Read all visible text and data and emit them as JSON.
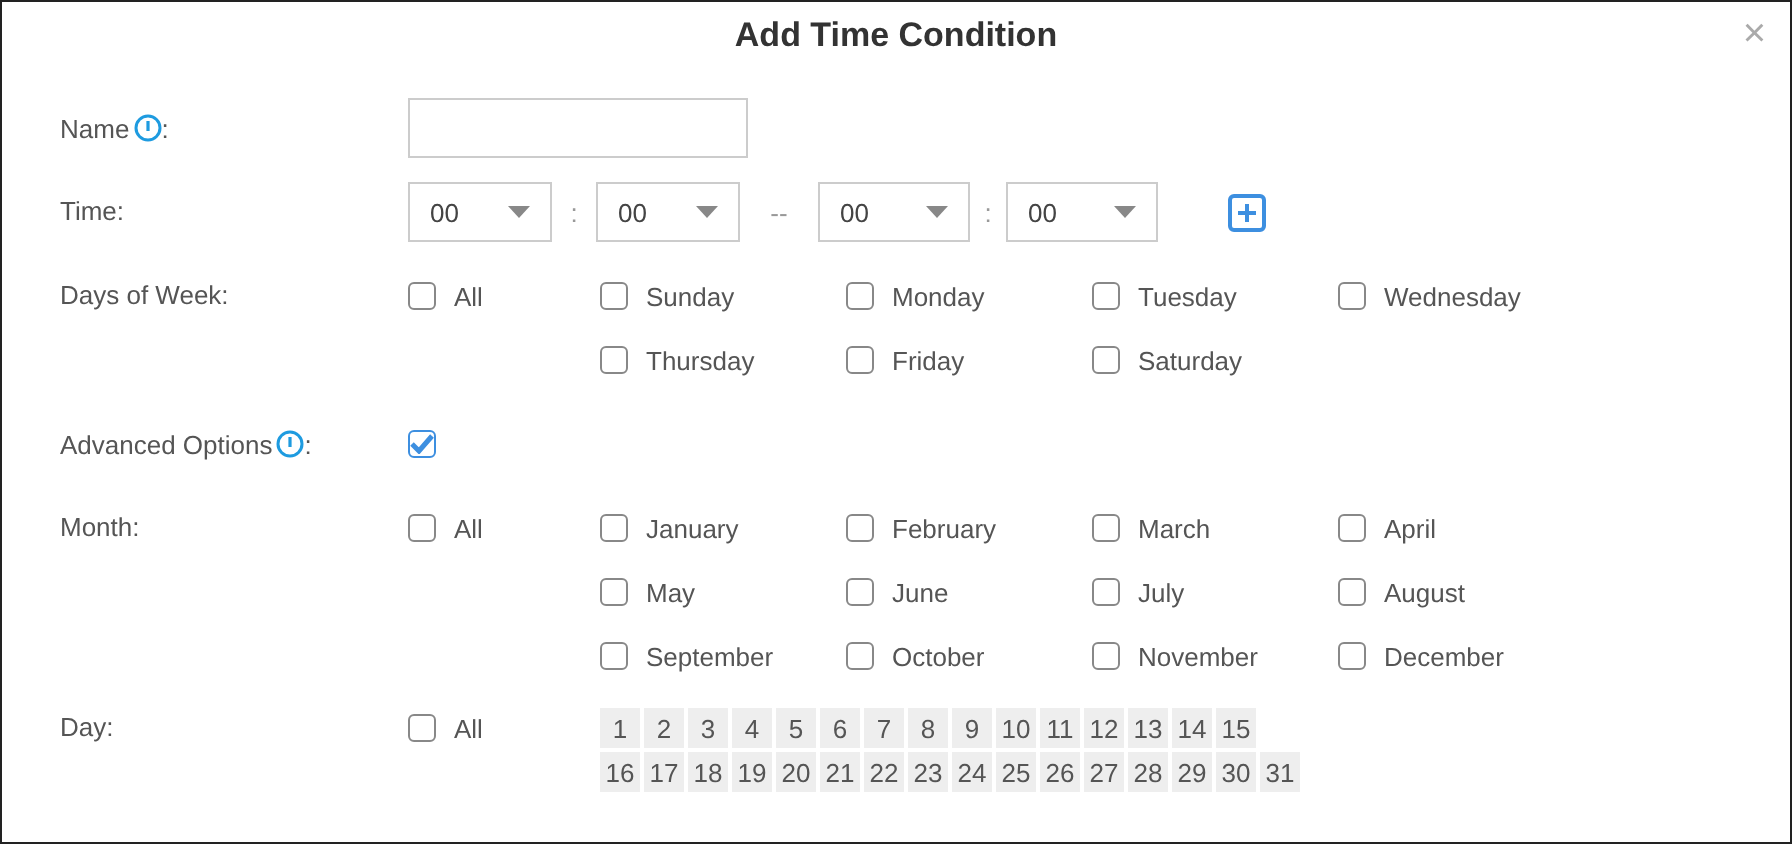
{
  "dialog": {
    "title": "Add Time Condition",
    "close": "×"
  },
  "name": {
    "label": "Name",
    "suffix": ":"
  },
  "time": {
    "label": "Time:",
    "selects": [
      "00",
      "00",
      "00",
      "00"
    ],
    "colon": ":",
    "dash": "--"
  },
  "days_of_week": {
    "label": "Days of Week:",
    "all": {
      "label": "All",
      "checked": false
    },
    "items": [
      {
        "label": "Sunday",
        "checked": false
      },
      {
        "label": "Monday",
        "checked": false
      },
      {
        "label": "Tuesday",
        "checked": false
      },
      {
        "label": "Wednesday",
        "checked": false
      },
      {
        "label": "Thursday",
        "checked": false
      },
      {
        "label": "Friday",
        "checked": false
      },
      {
        "label": "Saturday",
        "checked": false
      }
    ]
  },
  "advanced": {
    "label": "Advanced Options",
    "suffix": ":",
    "checked": true
  },
  "month": {
    "label": "Month:",
    "all": {
      "label": "All",
      "checked": false
    },
    "items": [
      {
        "label": "January",
        "checked": false
      },
      {
        "label": "February",
        "checked": false
      },
      {
        "label": "March",
        "checked": false
      },
      {
        "label": "April",
        "checked": false
      },
      {
        "label": "May",
        "checked": false
      },
      {
        "label": "June",
        "checked": false
      },
      {
        "label": "July",
        "checked": false
      },
      {
        "label": "August",
        "checked": false
      },
      {
        "label": "September",
        "checked": false
      },
      {
        "label": "October",
        "checked": false
      },
      {
        "label": "November",
        "checked": false
      },
      {
        "label": "December",
        "checked": false
      }
    ]
  },
  "day": {
    "label": "Day:",
    "all": {
      "label": "All",
      "checked": false
    },
    "lines": [
      {
        "days": [
          {
            "label": "1",
            "selected": false
          },
          {
            "label": "2",
            "selected": false
          },
          {
            "label": "3",
            "selected": false
          },
          {
            "label": "4",
            "selected": false
          },
          {
            "label": "5",
            "selected": false
          },
          {
            "label": "6",
            "selected": false
          },
          {
            "label": "7",
            "selected": false
          },
          {
            "label": "8",
            "selected": false
          },
          {
            "label": "9",
            "selected": false
          },
          {
            "label": "10",
            "selected": false
          },
          {
            "label": "11",
            "selected": false
          },
          {
            "label": "12",
            "selected": false
          },
          {
            "label": "13",
            "selected": false
          },
          {
            "label": "14",
            "selected": false
          },
          {
            "label": "15",
            "selected": false
          }
        ]
      },
      {
        "days": [
          {
            "label": "16",
            "selected": false
          },
          {
            "label": "17",
            "selected": false
          },
          {
            "label": "18",
            "selected": false
          },
          {
            "label": "19",
            "selected": false
          },
          {
            "label": "20",
            "selected": false
          },
          {
            "label": "21",
            "selected": false
          },
          {
            "label": "22",
            "selected": false
          },
          {
            "label": "23",
            "selected": false
          },
          {
            "label": "24",
            "selected": false
          },
          {
            "label": "25",
            "selected": false
          },
          {
            "label": "26",
            "selected": false
          },
          {
            "label": "27",
            "selected": false
          },
          {
            "label": "28",
            "selected": false
          },
          {
            "label": "29",
            "selected": false
          },
          {
            "label": "30",
            "selected": false
          },
          {
            "label": "31",
            "selected": false
          }
        ]
      }
    ]
  }
}
